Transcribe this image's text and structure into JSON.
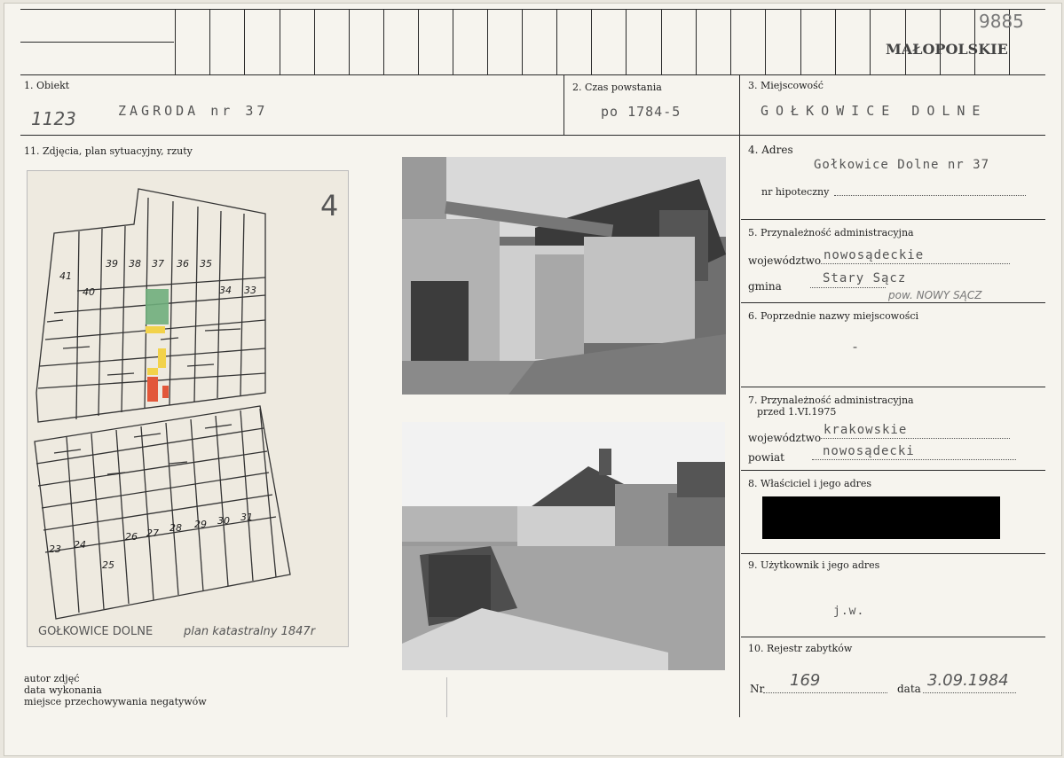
{
  "header": {
    "region": "MAŁOPOLSKIE",
    "archive_number": "9885"
  },
  "fields": {
    "obiekt": {
      "label": "1. Obiekt",
      "value": "ZAGRODA nr 37",
      "inventory_no": "1123"
    },
    "czas": {
      "label": "2. Czas powstania",
      "value": "po 1784-5"
    },
    "miejscowosc": {
      "label": "3. Miejscowość",
      "value": "GOŁKOWICE DOLNE"
    },
    "photos_label": "11. Zdjęcia, plan sytuacyjny, rzuty",
    "adres": {
      "label": "4. Adres",
      "value": "Gołkowice Dolne nr 37",
      "hipoteczny_label": "nr hipoteczny"
    },
    "przynaleznosc": {
      "label": "5. Przynależność administracyjna",
      "woj_label": "województwo",
      "woj_value": "nowosądeckie",
      "gmina_label": "gmina",
      "gmina_value": "Stary Sącz",
      "pow_note": "pow. NOWY SĄCZ"
    },
    "poprzednie": {
      "label": "6. Poprzednie nazwy miejscowości",
      "value": "-"
    },
    "przed1975": {
      "label1": "7. Przynależność administracyjna",
      "label2": "przed 1.VI.1975",
      "woj_label": "województwo",
      "woj_value": "krakowskie",
      "powiat_label": "powiat",
      "powiat_value": "nowosądecki"
    },
    "wlasciciel": {
      "label": "8. Właściciel i jego adres"
    },
    "uzytkownik": {
      "label": "9. Użytkownik i jego adres",
      "value": "j.w."
    },
    "rejestr": {
      "label": "10. Rejestr zabytków",
      "nr_label": "Nr",
      "nr_value": "169",
      "data_label": "data",
      "data_value": "3.09.1984"
    },
    "footer": {
      "autor": "autor zdjęć",
      "data": "data wykonania",
      "miejsce": "miejsce przechowywania negatywów"
    }
  },
  "plan": {
    "sheet_no": "4",
    "caption_place": "GOŁKOWICE DOLNE",
    "caption_plan": "plan katastralny 1847r",
    "parcels_top": [
      "41",
      "40",
      "39",
      "38",
      "37",
      "36",
      "35",
      "34",
      "33"
    ],
    "parcels_bottom": [
      "23",
      "24",
      "25",
      "26",
      "27",
      "28",
      "29",
      "30",
      "31"
    ]
  },
  "colors": {
    "highlight_green": "#6fae7c",
    "highlight_yellow": "#f2d24a",
    "highlight_red": "#e2573a"
  }
}
